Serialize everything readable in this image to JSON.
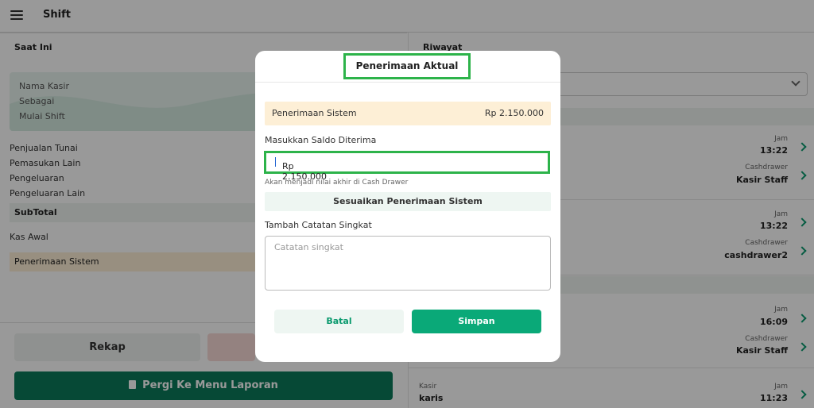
{
  "header": {
    "title": "Shift"
  },
  "left": {
    "current_title": "Saat Ini",
    "info": [
      "Nama Kasir",
      "Sebagai",
      "Mulai Shift"
    ],
    "lines": [
      "Penjualan Tunai",
      "Pemasukan Lain",
      "Pengeluaran",
      "Pengeluaran Lain"
    ],
    "subtotal": "SubTotal",
    "kas_awal": "Kas Awal",
    "system_receipt": "Penerimaan Sistem",
    "rekap_button": "Rekap",
    "report_button": "Pergi Ke Menu Laporan"
  },
  "right": {
    "history_title": "Riwayat",
    "entries": [
      {
        "jam_label": "Jam",
        "jam": "13:22",
        "drawer_label": "Cashdrawer",
        "drawer": "Kasir Staff"
      },
      {
        "jam_label": "Jam",
        "jam": "13:22",
        "drawer_label": "Cashdrawer",
        "drawer": "cashdrawer2"
      },
      {
        "jam_label": "Jam",
        "jam": "16:09",
        "drawer_label": "Cashdrawer",
        "drawer": "Kasir Staff"
      }
    ],
    "last": {
      "kasir_label": "Kasir",
      "kasir": "karis",
      "jam_label": "Jam",
      "jam": "11:23"
    }
  },
  "modal": {
    "title": "Penerimaan Aktual",
    "system_label": "Penerimaan Sistem",
    "system_value": "Rp 2.150.000",
    "input_label": "Masukkan Saldo Diterima",
    "input_value": "Rp 2.150.000",
    "hint": "Akan menjadi nilai akhir di Cash Drawer",
    "adjust_button": "Sesuaikan Penerimaan Sistem",
    "note_label": "Tambah Catatan Singkat",
    "note_placeholder": "Catatan singkat",
    "cancel_button": "Batal",
    "save_button": "Simpan"
  }
}
